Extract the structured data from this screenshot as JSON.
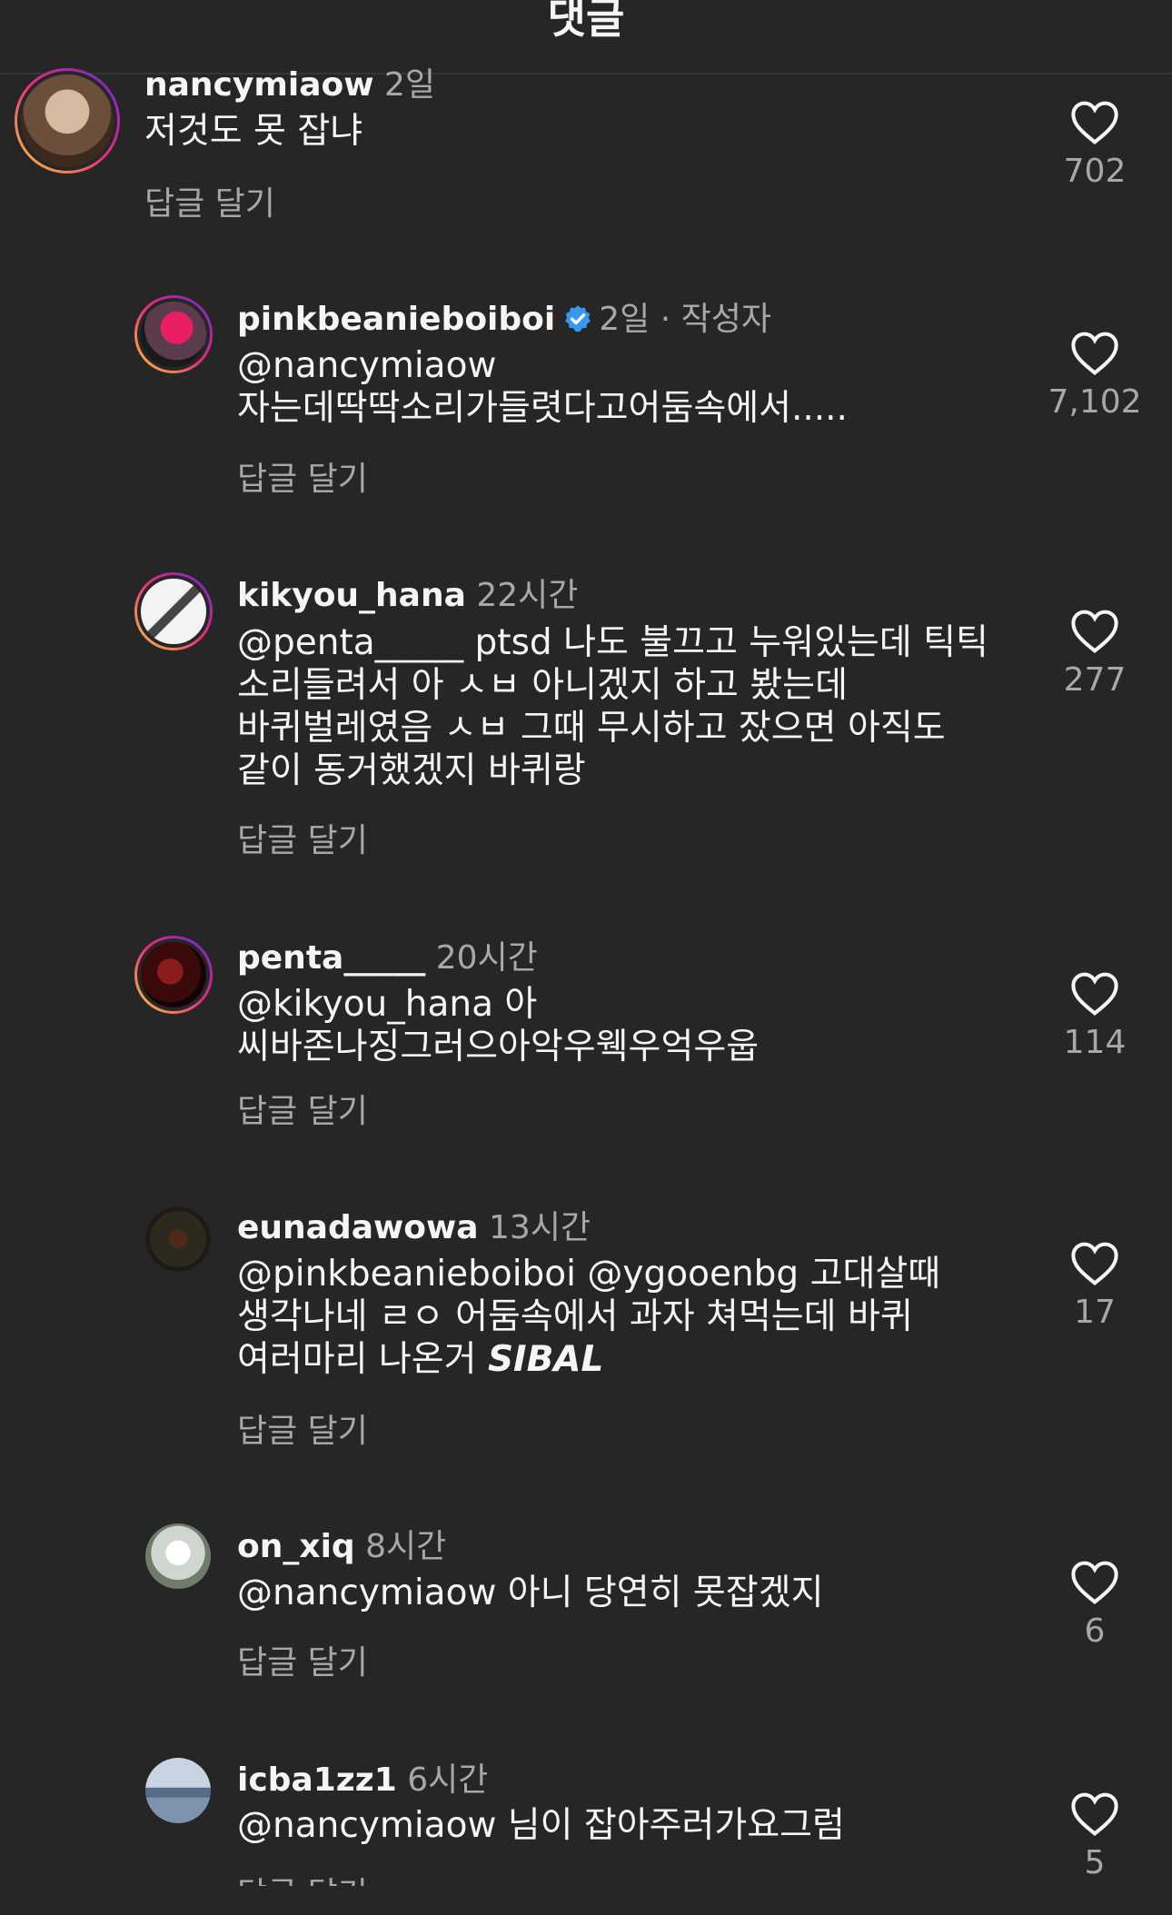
{
  "header": {
    "title": "댓글"
  },
  "comments": [
    {
      "username": "nancymiaow",
      "time": "2일",
      "text": "저것도 못 잡냐",
      "reply": "답글 달기",
      "likes": "702",
      "avatar_color": "#6b4f3a"
    },
    {
      "username": "pinkbeanieboiboi",
      "time": "2일 · 작성자",
      "text": "@nancymiaow 자는데딱딱소리가들렷다고어둠속에서.....",
      "reply": "답글 달기",
      "likes": "7,102",
      "avatar_color": "#c2185b",
      "verified": true
    },
    {
      "username": "kikyou_hana",
      "time": "22시간",
      "text": "@penta_____  ptsd 나도 불끄고 누워있는데 틱틱 소리들려서 아 ㅅㅂ 아니겠지 하고 봤는데 바퀴벌레였음 ㅅㅂ 그때 무시하고 잤으면 아직도 같이 동거했겠지 바퀴랑",
      "reply": "답글 달기",
      "likes": "277",
      "avatar_color": "#e8e8e8"
    },
    {
      "username": "penta_____",
      "time": "20시간",
      "text": "@kikyou_hana 아 씨바존나징그러으아악우웩우억우웁",
      "reply": "답글 달기",
      "likes": "114",
      "avatar_color": "#3a0a0a"
    },
    {
      "username": "eunadawowa",
      "time": "13시간",
      "text_main": "@pinkbeanieboiboi @ygooenbg 고대살때 생각나네 ㄹㅇ 어둠속에서 과자 쳐먹는데 바퀴 여러마리 나온거 ",
      "text_bold": "SIBAL",
      "reply": "답글 달기",
      "likes": "17",
      "avatar_color": "#2c2a1e"
    },
    {
      "username": "on_xiq",
      "time": "8시간",
      "text": "@nancymiaow 아니 당연히 못잡겠지",
      "reply": "답글 달기",
      "likes": "6",
      "avatar_color": "#cfd6cf"
    },
    {
      "username": "icba1zz1",
      "time": "6시간",
      "text": "@nancymiaow 님이 잡아주러가요그럼",
      "reply": "답글 달기",
      "likes": "5",
      "avatar_color": "#7d93ad"
    }
  ]
}
